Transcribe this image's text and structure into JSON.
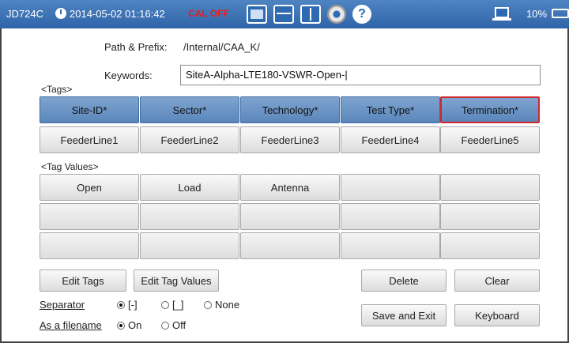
{
  "status": {
    "model": "JD724C",
    "datetime": "2014-05-02 01:16:42",
    "cal": "CAL OFF",
    "battery": "10%"
  },
  "form": {
    "path_label": "Path & Prefix:",
    "path_value": "/Internal/CAA_K/",
    "keywords_label": "Keywords:",
    "keywords_value": "SiteA-Alpha-LTE180-VSWR-Open-|",
    "tags_label": "<Tags>",
    "tag_values_label": "<Tag Values>"
  },
  "tags": [
    "Site-ID*",
    "Sector*",
    "Technology*",
    "Test Type*",
    "Termination*"
  ],
  "selected_tag": "Termination*",
  "feeder_tags": [
    "FeederLine1",
    "FeederLine2",
    "FeederLine3",
    "FeederLine4",
    "FeederLine5"
  ],
  "tag_values": [
    [
      "Open",
      "Load",
      "Antenna",
      "",
      ""
    ],
    [
      "",
      "",
      "",
      "",
      ""
    ],
    [
      "",
      "",
      "",
      "",
      ""
    ]
  ],
  "buttons": {
    "edit_tags": "Edit Tags",
    "edit_tag_values": "Edit Tag Values",
    "delete": "Delete",
    "clear": "Clear",
    "save_exit": "Save and Exit",
    "keyboard": "Keyboard"
  },
  "separator": {
    "label": "Separator",
    "options": [
      "[-]",
      "[_]",
      "None"
    ],
    "selected": "[-]"
  },
  "filename": {
    "label": "As a filename",
    "options": [
      "On",
      "Off"
    ],
    "selected": "On"
  }
}
